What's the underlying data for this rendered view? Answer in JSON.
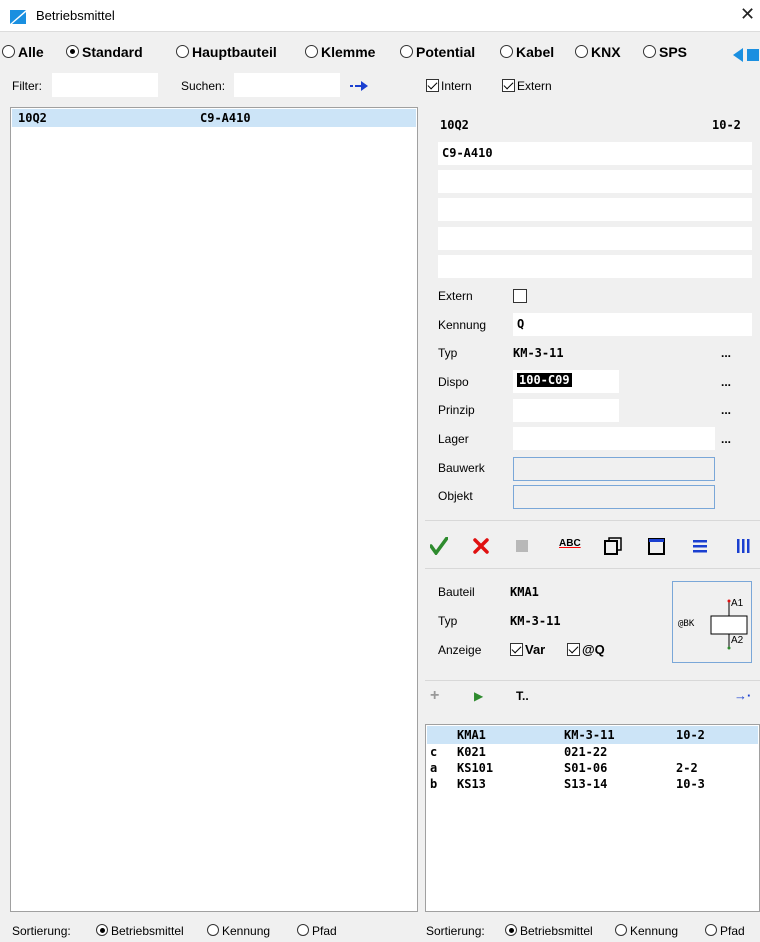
{
  "window": {
    "title": "Betriebsmittel",
    "close_glyph": "✕",
    "icon": "app-icon"
  },
  "filter_radios": {
    "items": [
      "Alle",
      "Standard",
      "Hauptbauteil",
      "Klemme",
      "Potential",
      "Kabel",
      "KNX",
      "SPS"
    ],
    "selected": "Standard"
  },
  "search": {
    "filter_label": "Filter:",
    "suchen_label": "Suchen:",
    "filter_value": "",
    "suchen_value": ""
  },
  "checks": {
    "intern_label": "Intern",
    "extern_label": "Extern",
    "intern": true,
    "extern": true
  },
  "left_list": {
    "rows": [
      {
        "col1": "10Q2",
        "col2": "C9-A410"
      }
    ]
  },
  "detail": {
    "name": "10Q2",
    "page": "10-2",
    "text_lines": [
      "C9-A410",
      "",
      "",
      "",
      ""
    ],
    "labels": {
      "extern": "Extern",
      "kennung": "Kennung",
      "typ": "Typ",
      "dispo": "Dispo",
      "prinzip": "Prinzip",
      "lager": "Lager",
      "bauwerk": "Bauwerk",
      "objekt": "Objekt"
    },
    "values": {
      "extern_checked": false,
      "kennung": "Q",
      "typ": "KM-3-11",
      "dispo": "100-C09",
      "prinzip": "",
      "lager": "",
      "bauwerk": "",
      "objekt": ""
    },
    "dots": "..."
  },
  "toolbar": {
    "icons": [
      "confirm-check-icon",
      "delete-x-icon",
      "stop-square-icon",
      "spellcheck-abc-icon",
      "copy-window-icon",
      "window-icon",
      "list-lines-icon",
      "columns-icon"
    ],
    "abc_text": "ABC"
  },
  "bauteil": {
    "labels": {
      "bauteil": "Bauteil",
      "typ": "Typ",
      "anzeige": "Anzeige"
    },
    "bauteil": "KMA1",
    "typ": "KM-3-11",
    "var_label": "Var",
    "q_label": "@Q",
    "var_checked": true,
    "q_checked": true,
    "symbol": {
      "bk": "@BK",
      "a1": "A1",
      "a2": "A2"
    }
  },
  "sub_toolbar": {
    "add": "+",
    "play": "▶",
    "t_label": "T..",
    "arrow": "→·"
  },
  "right_list": {
    "rows": [
      {
        "letter": "",
        "name": "KMA1",
        "contact": "KM-3-11",
        "page": "10-2"
      },
      {
        "letter": "c",
        "name": "K021",
        "contact": "021-22",
        "page": ""
      },
      {
        "letter": "a",
        "name": "KS101",
        "contact": "S01-06",
        "page": "2-2"
      },
      {
        "letter": "b",
        "name": "KS13",
        "contact": "S13-14",
        "page": "10-3"
      }
    ]
  },
  "sort_left": {
    "label": "Sortierung:",
    "options": [
      "Betriebsmittel",
      "Kennung",
      "Pfad"
    ],
    "selected": "Betriebsmittel"
  },
  "sort_right": {
    "label": "Sortierung:",
    "options": [
      "Betriebsmittel",
      "Kennung",
      "Pfad"
    ],
    "selected": "Betriebsmittel"
  },
  "colors": {
    "accent_blue": "#1a8fe0",
    "selection": "#cce4f7",
    "check_green": "#2e8b2e",
    "delete_red": "#e01010",
    "toolbar_blue": "#1a3fd0"
  }
}
